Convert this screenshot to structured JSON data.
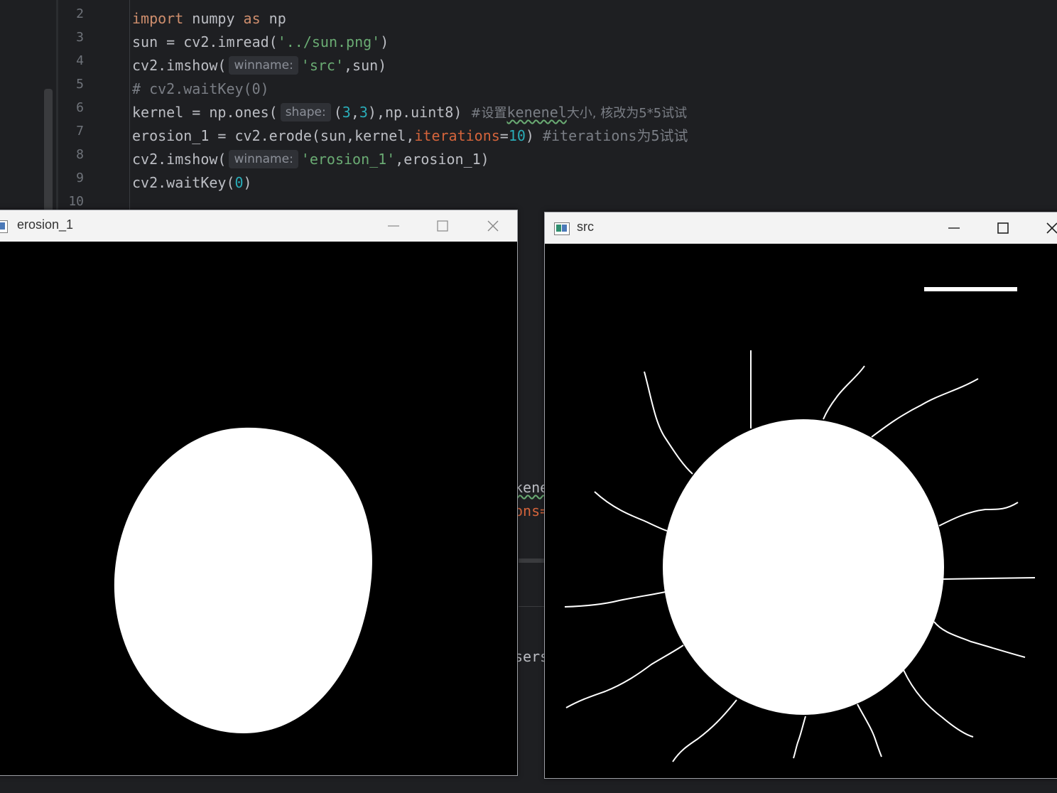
{
  "editor": {
    "line_numbers": [
      "2",
      "3",
      "4",
      "5",
      "6",
      "7",
      "8",
      "9",
      "10"
    ],
    "code": {
      "l2_kw_import": "import",
      "l2_mid": " numpy ",
      "l2_kw_as": "as",
      "l2_end": " np",
      "l3_start": "sun = cv2.imread(",
      "l3_str": "'../sun.png'",
      "l3_end": ")",
      "l4_start": "cv2.imshow(",
      "l4_hint": "winname:",
      "l4_str": "'src'",
      "l4_end": ",sun)",
      "l5_comment": "# cv2.waitKey(0)",
      "l6_start": "kernel = np.ones(",
      "l6_hint": "shape:",
      "l6_p1": "(",
      "l6_n1": "3",
      "l6_p2": ",",
      "l6_n2": "3",
      "l6_p3": "),np.uint8) ",
      "l6_com1": "#设置",
      "l6_com_wavy": "kenenel",
      "l6_com2": "大小, 核改为5*5试试",
      "l7_start": "erosion_1 = cv2.erode(sun,kernel,",
      "l7_param": "iterations",
      "l7_eq": "=",
      "l7_num": "10",
      "l7_close": ") ",
      "l7_com": "#iterations为5试试",
      "l8_start": "cv2.imshow(",
      "l8_hint": "winname:",
      "l8_str": "'erosion_1'",
      "l8_end": ",erosion_1)",
      "l9_start": "cv2.waitKey(",
      "l9_num": "0",
      "l9_end": ")"
    },
    "ghost": {
      "g1": "kene",
      "g2": "ons=",
      "g3": "sers"
    }
  },
  "windows": {
    "erosion": {
      "title": "erosion_1",
      "controls": [
        "minimize",
        "maximize",
        "close"
      ]
    },
    "src": {
      "title": "src",
      "controls": [
        "minimize",
        "maximize",
        "close"
      ]
    }
  },
  "colors": {
    "editor_bg": "#1e1f22",
    "keyword": "#cf8e6d",
    "string": "#6aab73",
    "number": "#2aacb8",
    "parameter": "#d5643b",
    "comment": "#7a7e85",
    "titlebar": "#f3f3f3"
  }
}
